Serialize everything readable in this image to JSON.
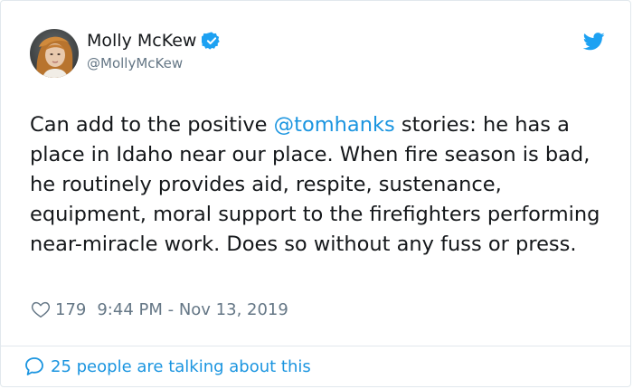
{
  "author": {
    "name": "Molly McKew",
    "handle": "@MollyMcKew",
    "verified": true
  },
  "tweet": {
    "text_before_mention": "Can add to the positive ",
    "mention": "@tomhanks",
    "text_after_mention": " stories: he has a place in Idaho near our place. When fire season is bad, he routinely provides aid, respite, sustenance, equipment, moral support to the firefighters performing near-miracle work. Does so without any fuss or press."
  },
  "meta": {
    "likes": "179",
    "timestamp": "9:44 PM - Nov 13, 2019"
  },
  "footer": {
    "conversation_label": "25 people are talking about this"
  },
  "icons": {
    "verified": "verified-badge-icon",
    "platform": "twitter-bird-icon",
    "like": "heart-icon",
    "reply": "speech-bubble-icon"
  },
  "colors": {
    "accent": "#1b95e0",
    "text": "#14171a",
    "secondary": "#657786",
    "border": "#e1e8ed"
  }
}
